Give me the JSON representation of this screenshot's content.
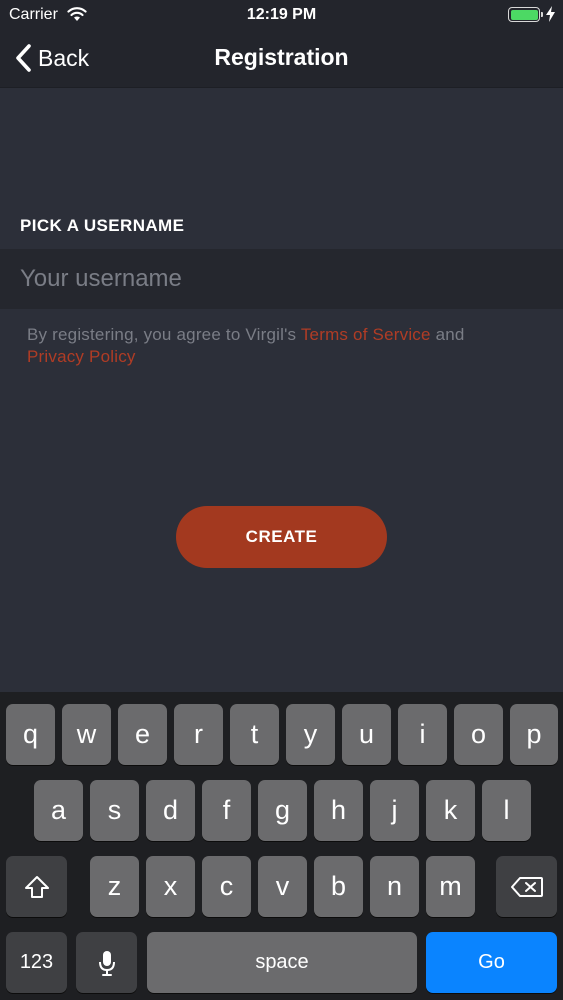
{
  "status_bar": {
    "carrier": "Carrier",
    "time": "12:19 PM",
    "battery_color": "#4cd964"
  },
  "nav": {
    "back_label": "Back",
    "title": "Registration",
    "back_icon": "chevron-left-icon"
  },
  "form": {
    "section_label": "PICK A USERNAME",
    "username_placeholder": "Your username",
    "username_value": "",
    "terms_prefix": "By registering, you agree to Virgil's ",
    "terms_link": "Terms of Service",
    "terms_and": " and",
    "privacy_link": "Privacy Policy",
    "link_color": "#b03c25"
  },
  "create_button": {
    "label": "CREATE",
    "color": "#a3391f"
  },
  "keyboard": {
    "row1": [
      "q",
      "w",
      "e",
      "r",
      "t",
      "y",
      "u",
      "i",
      "o",
      "p"
    ],
    "row2": [
      "a",
      "s",
      "d",
      "f",
      "g",
      "h",
      "j",
      "k",
      "l"
    ],
    "row3": [
      "z",
      "x",
      "c",
      "v",
      "b",
      "n",
      "m"
    ],
    "numbers_label": "123",
    "space_label": "space",
    "go_label": "Go",
    "go_color": "#0a84ff"
  }
}
